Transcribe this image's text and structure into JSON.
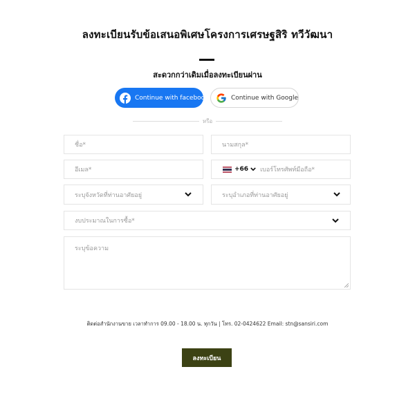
{
  "header": {
    "title": "ลงทะเบียนรับข้อเสนอพิเศษโครงการเศรษฐสิริ ทวีวัฒนา",
    "subtitle": "สะดวกกว่าเดิมเมื่อลงทะเบียนผ่าน"
  },
  "social": {
    "facebook_label": "Continue with facebook",
    "google_label": "Continue with Google",
    "facebook_color": "#1877f2"
  },
  "divider": {
    "text": "หรือ"
  },
  "form": {
    "first_name_placeholder": "ชื่อ*",
    "last_name_placeholder": "นามสกุล*",
    "email_placeholder": "อีเมล*",
    "phone": {
      "country_flag": "thailand-flag-icon",
      "dial_code": "+66",
      "placeholder": "เบอร์โทรศัพท์มือถือ*"
    },
    "province_placeholder": "ระบุจังหวัดที่ท่านอาศัยอยู่",
    "district_placeholder": "ระบุอำเภอที่ท่านอาศัยอยู่",
    "budget_placeholder": "งบประมาณในการซื้อ*",
    "message_placeholder": "ระบุข้อความ"
  },
  "footer": {
    "contact": "ติดต่อสำนักงานขาย เวลาทำการ 09.00 - 18.00 น. ทุกวัน | โทร. 02-0424622 Email: stn@sansiri.com",
    "submit_label": "ลงทะเบียน",
    "submit_color": "#3c4214"
  }
}
